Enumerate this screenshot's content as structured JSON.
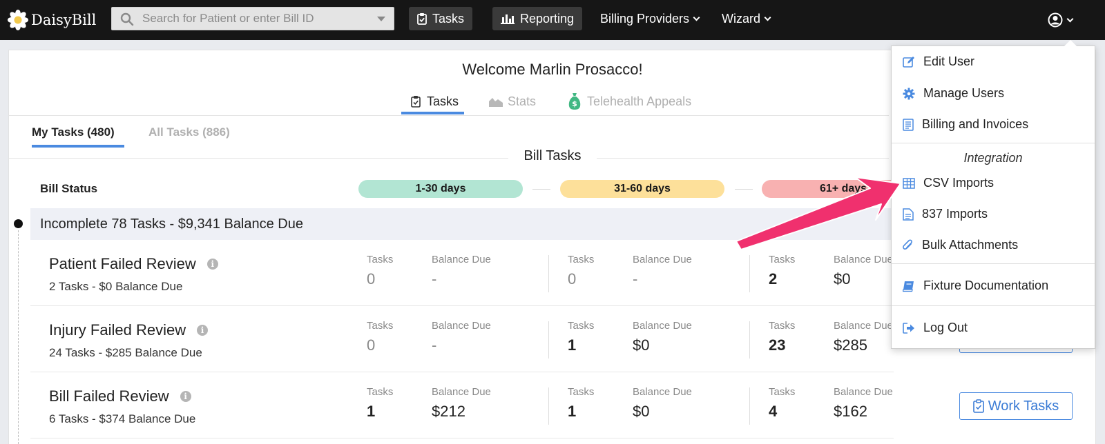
{
  "nav": {
    "brand": "DaisyBill",
    "search_placeholder": "Search for Patient or enter Bill ID",
    "tasks_label": "Tasks",
    "reporting_label": "Reporting",
    "billing_providers_label": "Billing Providers",
    "wizard_label": "Wizard"
  },
  "welcome": "Welcome Marlin Prosacco!",
  "top_tabs": [
    {
      "label": "Tasks",
      "active": true
    },
    {
      "label": "Stats",
      "active": false
    },
    {
      "label": "Telehealth Appeals",
      "active": false
    }
  ],
  "sub_tabs": [
    {
      "label": "My Tasks (480)",
      "active": true
    },
    {
      "label": "All Tasks (886)",
      "active": false
    }
  ],
  "section_title": "Bill Tasks",
  "bill_status_label": "Bill Status",
  "age_pills": [
    {
      "label": "1-30 days",
      "color": "#b2e5d3"
    },
    {
      "label": "31-60 days",
      "color": "#fde09a"
    },
    {
      "label": "61+ days",
      "color": "#f8b1b1"
    }
  ],
  "group": {
    "name": "Incomplete",
    "summary": "78 Tasks - $9,341 Balance Due"
  },
  "col_labels": {
    "tasks": "Tasks",
    "balance": "Balance Due"
  },
  "rows": [
    {
      "title": "Patient Failed Review",
      "subtitle": "2 Tasks - $0 Balance Due",
      "cells": [
        {
          "tasks": "0",
          "balance": "-"
        },
        {
          "tasks": "0",
          "balance": "-"
        },
        {
          "tasks": "2",
          "balance": "$0"
        }
      ]
    },
    {
      "title": "Injury Failed Review",
      "subtitle": "24 Tasks - $285 Balance Due",
      "cells": [
        {
          "tasks": "0",
          "balance": "-"
        },
        {
          "tasks": "1",
          "balance": "$0"
        },
        {
          "tasks": "23",
          "balance": "$285"
        }
      ]
    },
    {
      "title": "Bill Failed Review",
      "subtitle": "6 Tasks - $374 Balance Due",
      "cells": [
        {
          "tasks": "1",
          "balance": "$212"
        },
        {
          "tasks": "1",
          "balance": "$0"
        },
        {
          "tasks": "4",
          "balance": "$162"
        }
      ]
    }
  ],
  "work_tasks_label": "Work Tasks",
  "user_menu": {
    "edit_user": "Edit User",
    "manage_users": "Manage Users",
    "billing_invoices": "Billing and Invoices",
    "integration_header": "Integration",
    "csv_imports": "CSV Imports",
    "imports_837": "837 Imports",
    "bulk_attachments": "Bulk Attachments",
    "fixture_docs": "Fixture Documentation",
    "log_out": "Log Out"
  },
  "colors": {
    "accent": "#4a8ae0",
    "annotation_arrow": "#f0306e",
    "nav_bg": "#161616"
  }
}
